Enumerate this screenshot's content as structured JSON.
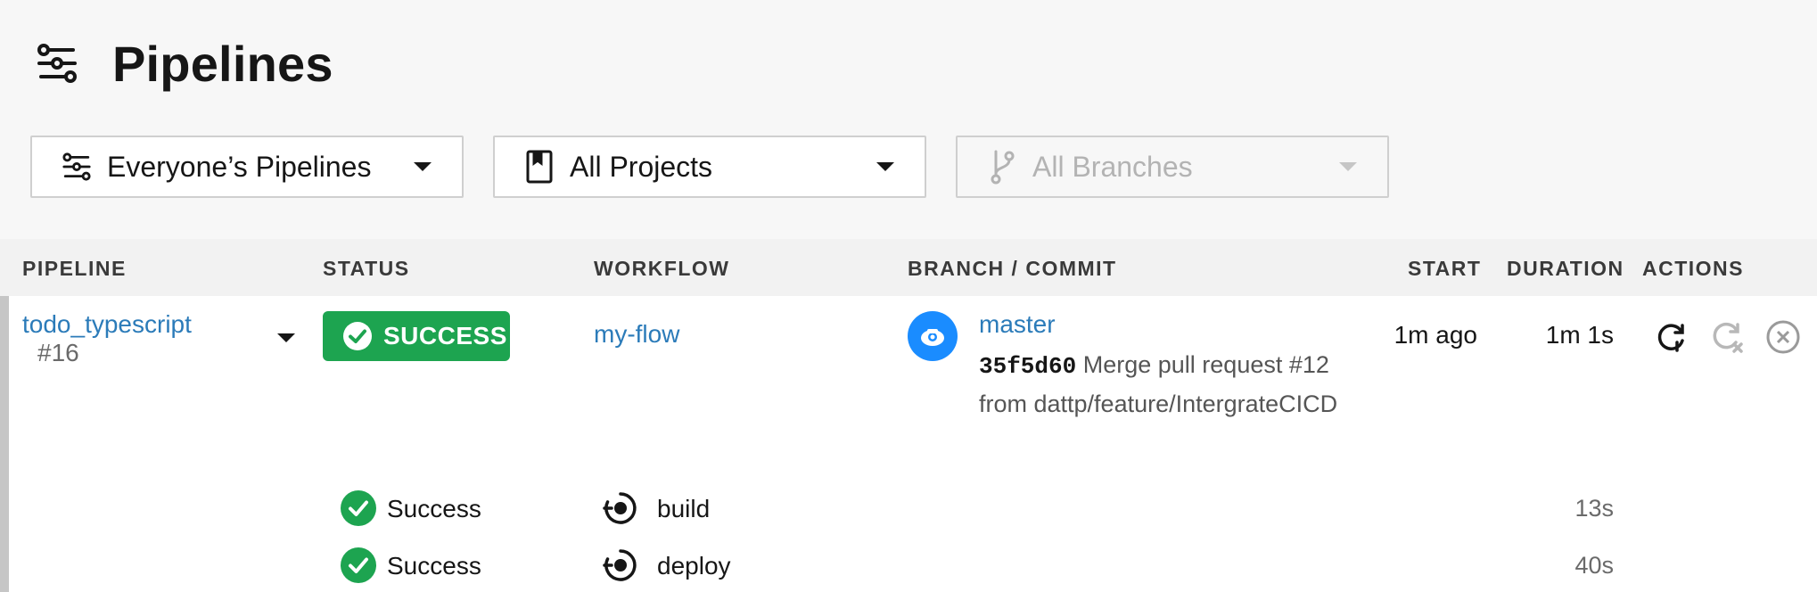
{
  "page": {
    "title": "Pipelines",
    "icon": "pipelines-icon"
  },
  "filters": {
    "pipelines": {
      "label": "Everyone’s Pipelines",
      "icon": "pipelines-icon"
    },
    "projects": {
      "label": "All Projects",
      "icon": "bookmark-icon"
    },
    "branches": {
      "label": "All Branches",
      "icon": "git-branch-icon",
      "disabled": true
    }
  },
  "columns": {
    "pipeline": "PIPELINE",
    "status": "STATUS",
    "workflow": "WORKFLOW",
    "branch_commit": "BRANCH / COMMIT",
    "start": "START",
    "duration": "DURATION",
    "actions": "ACTIONS"
  },
  "row": {
    "project": "todo_typescript",
    "number": "#16",
    "status": "SUCCESS",
    "workflow": "my-flow",
    "branch": "master",
    "commit_hash": "35f5d60",
    "commit_message": "Merge pull request #12 from dattp/feature/IntergrateCICD",
    "start": "1m ago",
    "duration": "1m 1s",
    "actions": [
      "rerun-icon",
      "rerun-failed-icon",
      "cancel-icon"
    ],
    "jobs": [
      {
        "status": "Success",
        "name": "build",
        "duration": "13s"
      },
      {
        "status": "Success",
        "name": "deploy",
        "duration": "40s"
      }
    ]
  },
  "colors": {
    "success": "#1da450",
    "link": "#2b7bb9",
    "avatar": "#1a8cff"
  }
}
